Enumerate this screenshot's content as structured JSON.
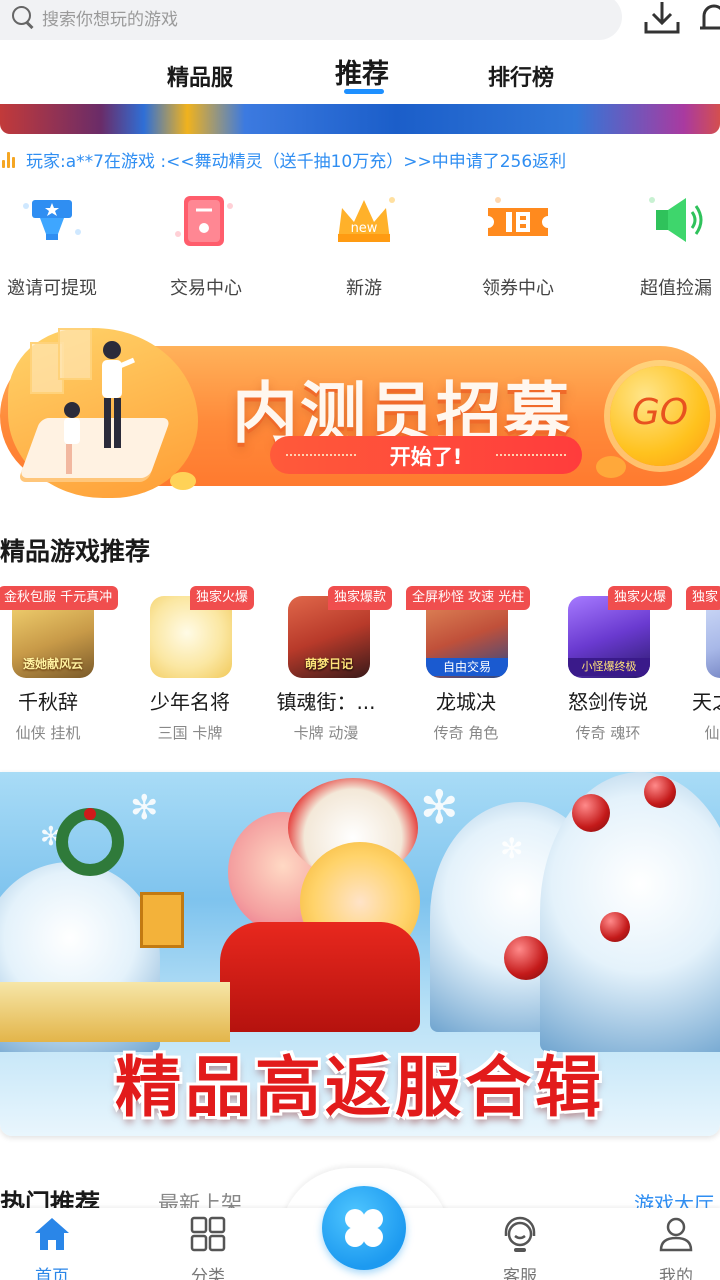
{
  "search": {
    "placeholder": "搜索你想玩的游戏"
  },
  "header": {
    "download_icon": "download-icon",
    "bell_icon": "bell-icon"
  },
  "tabs": [
    {
      "label": "精品服",
      "active": false
    },
    {
      "label": "推荐",
      "active": true
    },
    {
      "label": "排行榜",
      "active": false
    }
  ],
  "marquee": {
    "text": "玩家:a**7在游戏 :<<舞动精灵（送千抽10万充）>>中申请了256返利"
  },
  "quick_menu": [
    {
      "label": "邀请可提现",
      "icon": "trophy-icon"
    },
    {
      "label": "交易中心",
      "icon": "trade-icon"
    },
    {
      "label": "新游",
      "icon": "new-crown-icon"
    },
    {
      "label": "领券中心",
      "icon": "coupon-icon"
    },
    {
      "label": "超值捡漏",
      "icon": "megaphone-icon"
    }
  ],
  "recruit_banner": {
    "title": "内测员招募",
    "subtitle": "开始了!",
    "go_label": "GO"
  },
  "section_recommend": {
    "title": "精品游戏推荐"
  },
  "games": [
    {
      "badge": "金秋包服 千元真冲",
      "cover_text": "透她献风云",
      "name": "千秋辞",
      "tags": "仙侠 挂机",
      "colors": [
        "#f6d774",
        "#7a5a2a"
      ]
    },
    {
      "badge": "独家火爆",
      "cover_text": "",
      "name": "少年名将",
      "tags": "三国 卡牌",
      "colors": [
        "#fff4c2",
        "#f4c64a"
      ]
    },
    {
      "badge": "独家爆款",
      "cover_text": "萌梦日记",
      "name": "镇魂街：...",
      "tags": "卡牌 动漫",
      "colors": [
        "#b83a2a",
        "#3a1a1a"
      ]
    },
    {
      "badge": "全屏秒怪 攻速 光柱",
      "cover_text": "自由交易",
      "name": "龙城决",
      "tags": "传奇 角色",
      "colors": [
        "#c0503a",
        "#2a4a8a"
      ]
    },
    {
      "badge": "独家火爆",
      "cover_text": "小怪爆终极",
      "name": "怒剑传说",
      "tags": "传奇 魂环",
      "colors": [
        "#6a3ad0",
        "#2a1a6a"
      ]
    },
    {
      "badge": "独家",
      "cover_text": "",
      "name": "天之",
      "tags": "仙",
      "colors": [
        "#a8b8e8",
        "#5a6ab0"
      ]
    }
  ],
  "xmas_banner": {
    "headline": "精品高返服合辑"
  },
  "section_hot": {
    "title": "热门推荐",
    "latest": "最新上架",
    "more": "游戏大厅"
  },
  "bottom_nav": [
    {
      "label": "首页",
      "active": true,
      "icon": "home-icon"
    },
    {
      "label": "分类",
      "active": false,
      "icon": "grid-icon"
    },
    {
      "label": "客服",
      "active": false,
      "icon": "headset-icon"
    },
    {
      "label": "我的",
      "active": false,
      "icon": "user-icon"
    }
  ],
  "colors": {
    "accent": "#1e90ff",
    "marquee": "#2f8ef2",
    "badge": "#f04e4e",
    "banner_orange": "#ff8a3a"
  }
}
